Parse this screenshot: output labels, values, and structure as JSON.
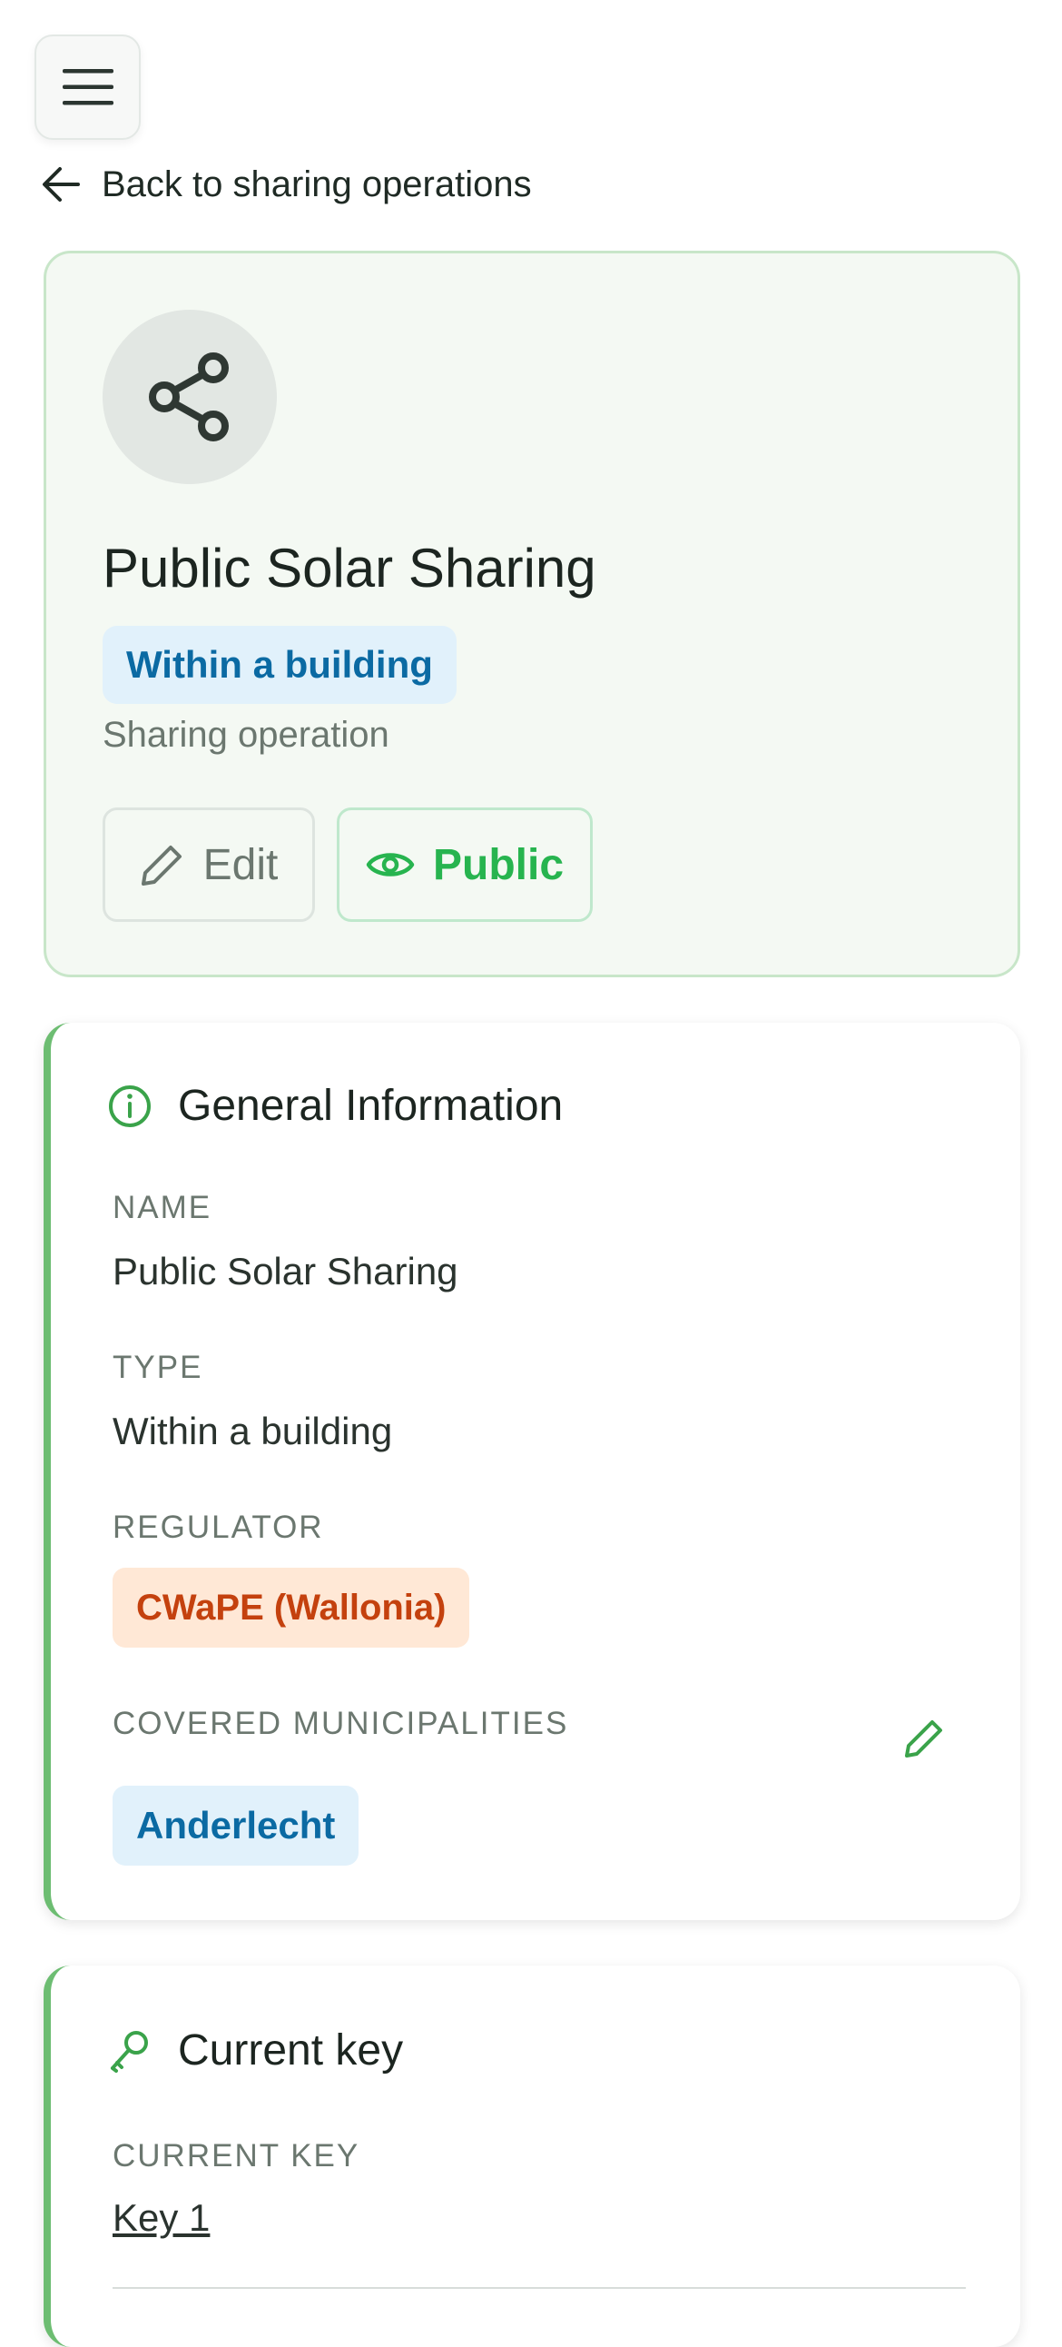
{
  "nav": {
    "menu_icon": "hamburger-menu-icon",
    "back_icon": "arrow-left-icon",
    "back_label": "Back to sharing operations"
  },
  "hero": {
    "avatar_icon": "share-icon",
    "title": "Public Solar Sharing",
    "type_badge": "Within a building",
    "subtitle": "Sharing operation",
    "edit_label": "Edit",
    "edit_icon": "pencil-icon",
    "public_label": "Public",
    "public_icon": "eye-icon"
  },
  "general_info": {
    "icon": "info-circle-icon",
    "title": "General Information",
    "name_label": "NAME",
    "name_value": "Public Solar Sharing",
    "type_label": "TYPE",
    "type_value": "Within a building",
    "regulator_label": "REGULATOR",
    "regulator_value": "CWaPE (Wallonia)",
    "municipalities_label": "COVERED MUNICIPALITIES",
    "municipalities_edit_icon": "pencil-icon",
    "municipalities": [
      "Anderlecht"
    ]
  },
  "current_key": {
    "icon": "key-icon",
    "title": "Current key",
    "key_label": "CURRENT KEY",
    "key_value": "Key 1"
  },
  "colors": {
    "accent_green": "#6dbd72",
    "public_green": "#27b44f",
    "badge_blue_bg": "#e1f1fb",
    "badge_blue_text": "#0b6aa3",
    "badge_orange_bg": "#ffe8d6",
    "badge_orange_text": "#c4410e"
  }
}
